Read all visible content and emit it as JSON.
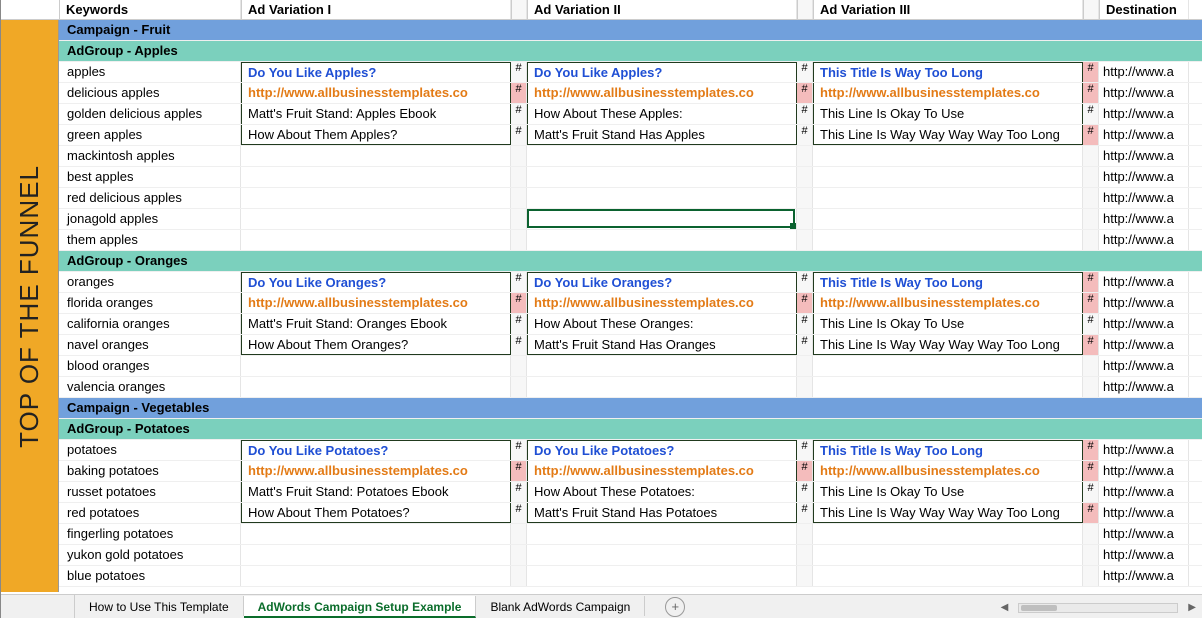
{
  "funnel_label": "TOP OF THE FUNNEL",
  "headers": {
    "keywords": "Keywords",
    "ad1": "Ad Variation I",
    "ad2": "Ad Variation II",
    "ad3": "Ad Variation III",
    "dest": "Destination"
  },
  "tabs": [
    "How to Use This Template",
    "AdWords Campaign Setup Example",
    "Blank AdWords Campaign"
  ],
  "active_tab": 1,
  "hash": "#",
  "url_fragment": "http://www.a",
  "blocks": [
    {
      "campaign": "Campaign - Fruit",
      "adgroups": [
        {
          "name": "AdGroup - Apples",
          "keywords": [
            "apples",
            "delicious apples",
            "golden delicious apples",
            "green apples",
            "mackintosh apples",
            "best apples",
            "red delicious apples",
            "jonagold apples",
            "them apples"
          ],
          "ads": {
            "v1": [
              "Do You Like Apples?",
              "http://www.allbusinesstemplates.co",
              "Matt's Fruit Stand: Apples Ebook",
              "How About Them Apples?"
            ],
            "v2": [
              "Do You Like Apples?",
              "http://www.allbusinesstemplates.co",
              "How About These Apples:",
              "Matt's Fruit Stand Has Apples"
            ],
            "v3": [
              "This Title Is Way Too Long",
              "http://www.allbusinesstemplates.co",
              "This Line Is Okay To Use",
              "This Line Is Way Way Way Way Too Long"
            ],
            "hash_pink": {
              "v1": [
                false,
                true,
                false,
                false
              ],
              "v2": [
                false,
                true,
                false,
                false
              ],
              "v3": [
                true,
                true,
                false,
                true
              ]
            }
          },
          "selected_row_idx": 7
        },
        {
          "name": "AdGroup - Oranges",
          "keywords": [
            "oranges",
            "florida oranges",
            "california oranges",
            "navel oranges",
            "blood oranges",
            "valencia oranges"
          ],
          "ads": {
            "v1": [
              "Do You Like Oranges?",
              "http://www.allbusinesstemplates.co",
              "Matt's Fruit Stand: Oranges Ebook",
              "How About Them Oranges?"
            ],
            "v2": [
              "Do You Like Oranges?",
              "http://www.allbusinesstemplates.co",
              "How About These Oranges:",
              "Matt's Fruit Stand Has Oranges"
            ],
            "v3": [
              "This Title Is Way Too Long",
              "http://www.allbusinesstemplates.co",
              "This Line Is Okay To Use",
              "This Line Is Way Way Way Way Too Long"
            ],
            "hash_pink": {
              "v1": [
                false,
                true,
                false,
                false
              ],
              "v2": [
                false,
                true,
                false,
                false
              ],
              "v3": [
                true,
                true,
                false,
                true
              ]
            }
          }
        }
      ]
    },
    {
      "campaign": "Campaign - Vegetables",
      "adgroups": [
        {
          "name": "AdGroup - Potatoes",
          "keywords": [
            "potatoes",
            "baking potatoes",
            "russet potatoes",
            "red potatoes",
            "fingerling potatoes",
            "yukon gold potatoes",
            "blue potatoes"
          ],
          "ads": {
            "v1": [
              "Do You Like Potatoes?",
              "http://www.allbusinesstemplates.co",
              "Matt's Fruit Stand: Potatoes Ebook",
              "How About Them Potatoes?"
            ],
            "v2": [
              "Do You Like Potatoes?",
              "http://www.allbusinesstemplates.co",
              "How About These Potatoes:",
              "Matt's Fruit Stand Has Potatoes"
            ],
            "v3": [
              "This Title Is Way Too Long",
              "http://www.allbusinesstemplates.co",
              "This Line Is Okay To Use",
              "This Line Is Way Way Way Way Too Long"
            ],
            "hash_pink": {
              "v1": [
                false,
                true,
                false,
                false
              ],
              "v2": [
                false,
                true,
                false,
                false
              ],
              "v3": [
                true,
                true,
                false,
                true
              ]
            }
          }
        }
      ]
    }
  ]
}
